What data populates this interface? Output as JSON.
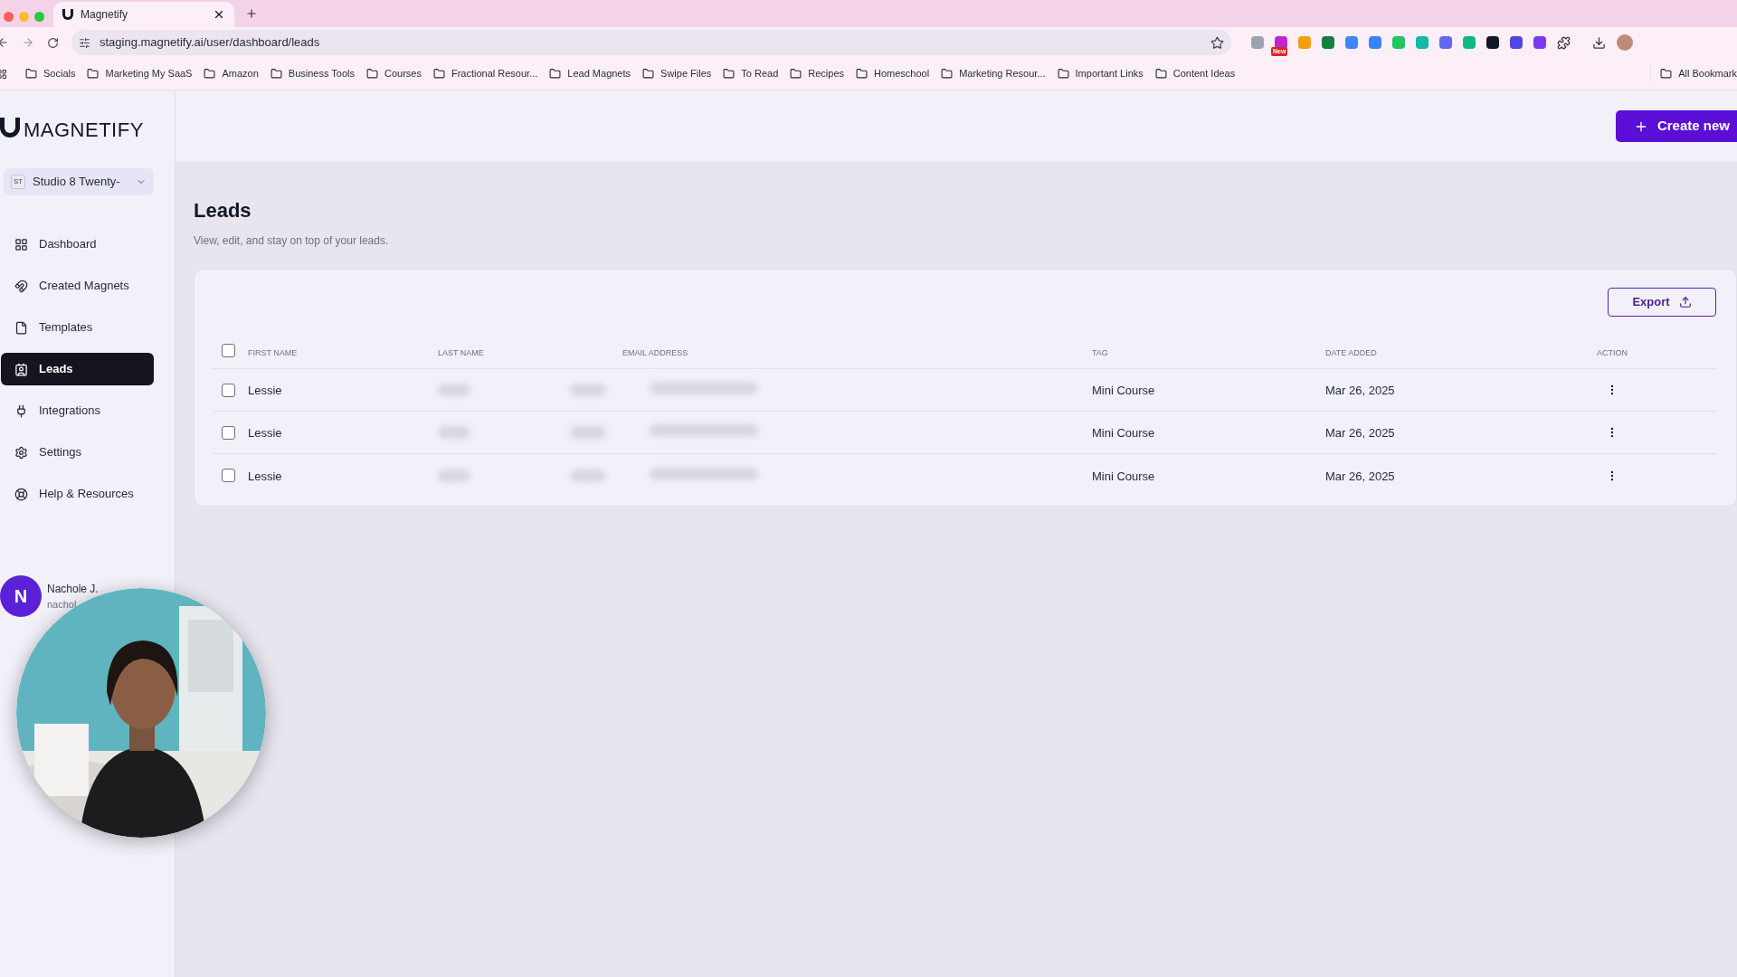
{
  "browser": {
    "tab_title": "Magnetify",
    "url": "staging.magnetify.ai/user/dashboard/leads",
    "new_badge": "New",
    "bookmarks": [
      "Socials",
      "Marketing My SaaS",
      "Amazon",
      "Business Tools",
      "Courses",
      "Fractional Resour...",
      "Lead Magnets",
      "Swipe Files",
      "To Read",
      "Recipes",
      "Homeschool",
      "Marketing Resour...",
      "Important Links",
      "Content Ideas"
    ],
    "all_bookmarks": "All Bookmark"
  },
  "sidebar": {
    "logo": "MAGNETIFY",
    "workspace": {
      "initials": "ST",
      "name": "Studio 8 Twenty-"
    },
    "items": [
      {
        "kind": "dashboard",
        "label": "Dashboard",
        "selected": false
      },
      {
        "kind": "magnets",
        "label": "Created Magnets",
        "selected": false
      },
      {
        "kind": "templates",
        "label": "Templates",
        "selected": false
      },
      {
        "kind": "leads",
        "label": "Leads",
        "selected": true
      },
      {
        "kind": "integrations",
        "label": "Integrations",
        "selected": false
      },
      {
        "kind": "settings",
        "label": "Settings",
        "selected": false
      },
      {
        "kind": "help",
        "label": "Help & Resources",
        "selected": false
      }
    ],
    "user": {
      "initial": "N",
      "name": "Nachole J.",
      "email": "nachol"
    }
  },
  "header": {
    "create_button": "Create new"
  },
  "page": {
    "title": "Leads",
    "subtitle": "View, edit, and stay on top of your leads.",
    "export_button": "Export"
  },
  "table": {
    "select_all_checked": false,
    "columns": [
      "FIRST NAME",
      "LAST NAME",
      "EMAIL ADDRESS",
      "TAG",
      "DATE ADDED",
      "ACTION"
    ],
    "rows": [
      {
        "first_name": "Lessie",
        "tag": "Mini Course",
        "date_added": "Mar 26, 2025",
        "checked": false
      },
      {
        "first_name": "Lessie",
        "tag": "Mini Course",
        "date_added": "Mar 26, 2025",
        "checked": false
      },
      {
        "first_name": "Lessie",
        "tag": "Mini Course",
        "date_added": "Mar 26, 2025",
        "checked": false
      }
    ]
  }
}
